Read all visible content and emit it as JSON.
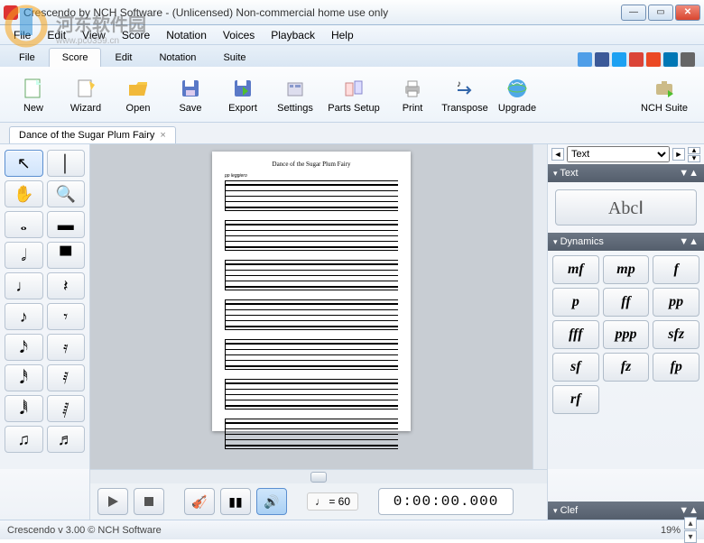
{
  "window": {
    "title": "Crescendo by NCH Software - (Unlicensed) Non-commercial home use only"
  },
  "menubar": [
    "File",
    "Edit",
    "View",
    "Score",
    "Notation",
    "Voices",
    "Playback",
    "Help"
  ],
  "ribbon_tabs": [
    {
      "label": "File",
      "active": false,
      "style": "file"
    },
    {
      "label": "Score",
      "active": true,
      "style": "score"
    },
    {
      "label": "Edit",
      "active": false
    },
    {
      "label": "Notation",
      "active": false
    },
    {
      "label": "Suite",
      "active": false
    }
  ],
  "social_icons": [
    {
      "name": "thumbs-up-icon",
      "color": "#4f9ee8"
    },
    {
      "name": "facebook-icon",
      "color": "#3b5998"
    },
    {
      "name": "twitter-icon",
      "color": "#1da1f2"
    },
    {
      "name": "google-plus-icon",
      "color": "#db4437"
    },
    {
      "name": "stumbleupon-icon",
      "color": "#eb4924"
    },
    {
      "name": "linkedin-icon",
      "color": "#0077b5"
    },
    {
      "name": "share-icon",
      "color": "#666"
    }
  ],
  "toolbar": [
    {
      "label": "New",
      "icon": "new"
    },
    {
      "label": "Wizard",
      "icon": "wizard"
    },
    {
      "label": "Open",
      "icon": "open"
    },
    {
      "label": "Save",
      "icon": "save"
    },
    {
      "label": "Export",
      "icon": "export"
    },
    {
      "label": "Settings",
      "icon": "settings"
    },
    {
      "label": "Parts Setup",
      "icon": "parts",
      "wide": true
    },
    {
      "label": "Print",
      "icon": "print"
    },
    {
      "label": "Transpose",
      "icon": "transpose"
    },
    {
      "label": "Upgrade",
      "icon": "upgrade"
    },
    {
      "label": "NCH Suite",
      "icon": "suite",
      "wide": true,
      "right": true
    }
  ],
  "document": {
    "tab_label": "Dance of the Sugar Plum Fairy",
    "page_title": "Dance of the Sugar Plum Fairy",
    "marking": "pp  leggiero"
  },
  "palette_tools": [
    {
      "name": "pointer-tool",
      "glyph": "↖",
      "selected": true
    },
    {
      "name": "barline-tool",
      "glyph": "│"
    },
    {
      "name": "hand-tool",
      "glyph": "✋"
    },
    {
      "name": "zoom-tool",
      "glyph": "🔍"
    },
    {
      "name": "whole-note",
      "glyph": "𝅝"
    },
    {
      "name": "whole-rest",
      "glyph": "▬"
    },
    {
      "name": "half-note",
      "glyph": "𝅗𝅥"
    },
    {
      "name": "half-rest",
      "glyph": "▀"
    },
    {
      "name": "quarter-note",
      "glyph": "♩"
    },
    {
      "name": "quarter-rest",
      "glyph": "𝄽"
    },
    {
      "name": "eighth-note",
      "glyph": "♪"
    },
    {
      "name": "eighth-rest",
      "glyph": "𝄾"
    },
    {
      "name": "sixteenth-note",
      "glyph": "𝅘𝅥𝅯"
    },
    {
      "name": "sixteenth-rest",
      "glyph": "𝄿"
    },
    {
      "name": "thirtysecond-note",
      "glyph": "𝅘𝅥𝅰"
    },
    {
      "name": "thirtysecond-rest",
      "glyph": "𝅀"
    },
    {
      "name": "sixtyfourth-note",
      "glyph": "𝅘𝅥𝅱"
    },
    {
      "name": "sixtyfourth-rest",
      "glyph": "𝅁"
    },
    {
      "name": "beam-group",
      "glyph": "♫"
    },
    {
      "name": "beam-group-4",
      "glyph": "♬"
    }
  ],
  "right_panel": {
    "selector_value": "Text",
    "sections": {
      "text": {
        "title": "Text",
        "button": "AbcⅠ"
      },
      "dynamics": {
        "title": "Dynamics",
        "items": [
          "mf",
          "mp",
          "f",
          "p",
          "ff",
          "pp",
          "fff",
          "ppp",
          "sfz",
          "sf",
          "fz",
          "fp",
          "rf"
        ]
      },
      "clef": {
        "title": "Clef"
      }
    }
  },
  "playback": {
    "tempo_label": "♩ = 60",
    "timecode": "0:00:00.000"
  },
  "status": {
    "left": "Crescendo v 3.00 © NCH Software",
    "zoom": "19%"
  }
}
